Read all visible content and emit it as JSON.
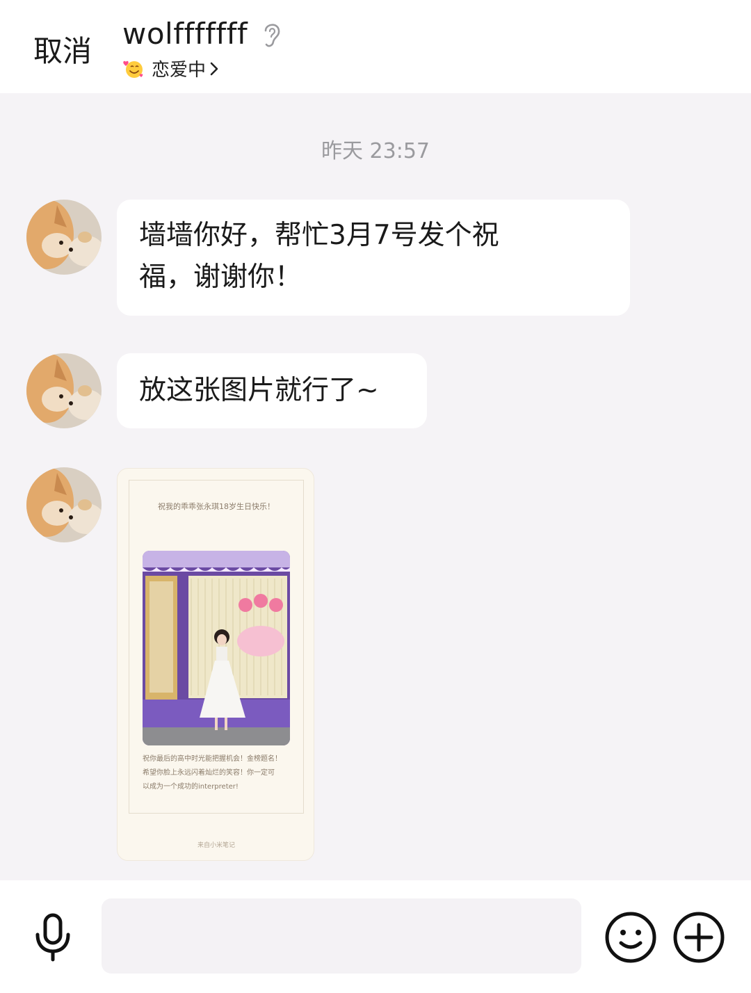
{
  "header": {
    "cancel_label": "取消",
    "contact_name": "wolfffffff",
    "status_label": "恋爱中"
  },
  "chat": {
    "timestamp": "昨天 23:57",
    "messages": [
      {
        "type": "text",
        "lines": [
          "墙墙你好，帮忙3月7号发个祝",
          "福，谢谢你！"
        ]
      },
      {
        "type": "text",
        "lines": [
          "放这张图片就行了~"
        ]
      },
      {
        "type": "image",
        "card": {
          "title": "祝我的乖乖张永琪18岁生日快乐！",
          "body_lines": [
            "祝你最后的高中时光能把握机会！金榜题名！",
            "希望你脸上永远闪着灿烂的笑容！你一定可",
            "以成为一个成功的interpreter!"
          ],
          "source": "来自小米笔记"
        }
      }
    ]
  },
  "footer": {
    "input_value": "",
    "input_placeholder": ""
  },
  "icons": {
    "ear": "ear-icon",
    "status": "smiling-face-with-hearts-icon",
    "chevron": "chevron-right-icon",
    "mic": "microphone-icon",
    "emoji": "smiley-face-icon",
    "plus": "plus-circle-icon"
  },
  "colors": {
    "background": "#f5f3f6",
    "bubble": "#ffffff",
    "timestamp": "#9a9a9e",
    "text": "#1a1a1a"
  }
}
